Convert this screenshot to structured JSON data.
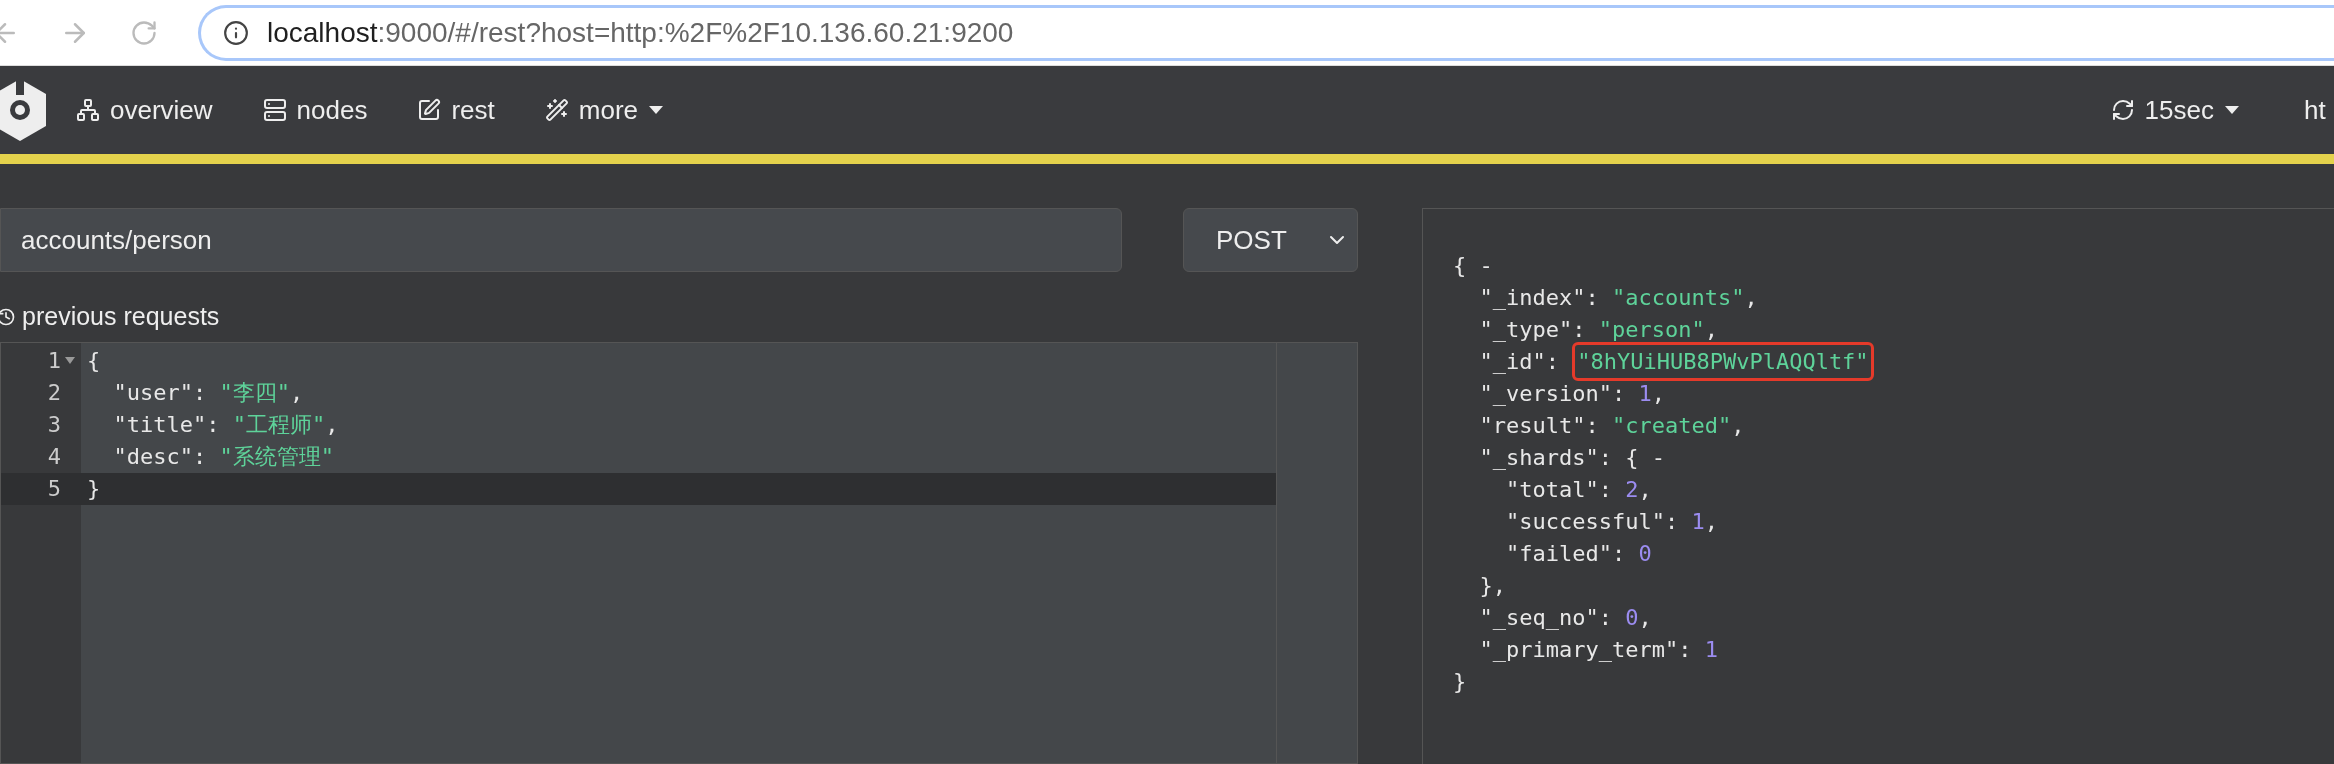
{
  "browser": {
    "url_host": "localhost",
    "url_path": ":9000/#/rest?host=http:%2F%2F10.136.60.21:9200"
  },
  "navbar": {
    "items": [
      {
        "label": "overview",
        "kind": "overview"
      },
      {
        "label": "nodes",
        "kind": "nodes"
      },
      {
        "label": "rest",
        "kind": "rest"
      },
      {
        "label": "more",
        "kind": "more"
      }
    ],
    "refresh": "15sec",
    "cut_item": "ht"
  },
  "request": {
    "path": "accounts/person",
    "method": "POST",
    "history_link": "previous requests"
  },
  "editor": {
    "lines": [
      {
        "number": "1",
        "foldable": true,
        "selected": false,
        "tokens": [
          {
            "kind": "punct",
            "text": "{"
          }
        ]
      },
      {
        "number": "2",
        "foldable": false,
        "selected": false,
        "tokens": [
          {
            "kind": "key",
            "text": "  \"user\": "
          },
          {
            "kind": "string",
            "text": "\"李四\""
          },
          {
            "kind": "punct",
            "text": ","
          }
        ]
      },
      {
        "number": "3",
        "foldable": false,
        "selected": false,
        "tokens": [
          {
            "kind": "key",
            "text": "  \"title\": "
          },
          {
            "kind": "string",
            "text": "\"工程师\""
          },
          {
            "kind": "punct",
            "text": ","
          }
        ]
      },
      {
        "number": "4",
        "foldable": false,
        "selected": false,
        "tokens": [
          {
            "kind": "key",
            "text": "  \"desc\": "
          },
          {
            "kind": "string",
            "text": "\"系统管理\""
          }
        ]
      },
      {
        "number": "5",
        "foldable": false,
        "selected": true,
        "tokens": [
          {
            "kind": "punct",
            "text": "}"
          }
        ]
      }
    ]
  },
  "response": {
    "lines": [
      [
        {
          "kind": "punct",
          "text": "{ -"
        }
      ],
      [
        {
          "kind": "key",
          "text": "  \"_index\": "
        },
        {
          "kind": "string",
          "text": "\"accounts\""
        },
        {
          "kind": "punct",
          "text": ","
        }
      ],
      [
        {
          "kind": "key",
          "text": "  \"_type\": "
        },
        {
          "kind": "string",
          "text": "\"person\""
        },
        {
          "kind": "punct",
          "text": ","
        }
      ],
      [
        {
          "kind": "key",
          "text": "  \"_id\": "
        },
        {
          "kind": "string",
          "text": "\"8hYUiHUB8PWvPlAQQltf\"",
          "annotated": true
        }
      ],
      [
        {
          "kind": "key",
          "text": "  \"_version\": "
        },
        {
          "kind": "number",
          "text": "1"
        },
        {
          "kind": "punct",
          "text": ","
        }
      ],
      [
        {
          "kind": "key",
          "text": "  \"result\": "
        },
        {
          "kind": "string",
          "text": "\"created\""
        },
        {
          "kind": "punct",
          "text": ","
        }
      ],
      [
        {
          "kind": "key",
          "text": "  \"_shards\": { -"
        }
      ],
      [
        {
          "kind": "key",
          "text": "    \"total\": "
        },
        {
          "kind": "number",
          "text": "2"
        },
        {
          "kind": "punct",
          "text": ","
        }
      ],
      [
        {
          "kind": "key",
          "text": "    \"successful\": "
        },
        {
          "kind": "number",
          "text": "1"
        },
        {
          "kind": "punct",
          "text": ","
        }
      ],
      [
        {
          "kind": "key",
          "text": "    \"failed\": "
        },
        {
          "kind": "number",
          "text": "0"
        }
      ],
      [
        {
          "kind": "punct",
          "text": "  },"
        }
      ],
      [
        {
          "kind": "key",
          "text": "  \"_seq_no\": "
        },
        {
          "kind": "number",
          "text": "0"
        },
        {
          "kind": "punct",
          "text": ","
        }
      ],
      [
        {
          "kind": "key",
          "text": "  \"_primary_term\": "
        },
        {
          "kind": "number",
          "text": "1"
        }
      ],
      [
        {
          "kind": "punct",
          "text": "}"
        }
      ]
    ]
  }
}
